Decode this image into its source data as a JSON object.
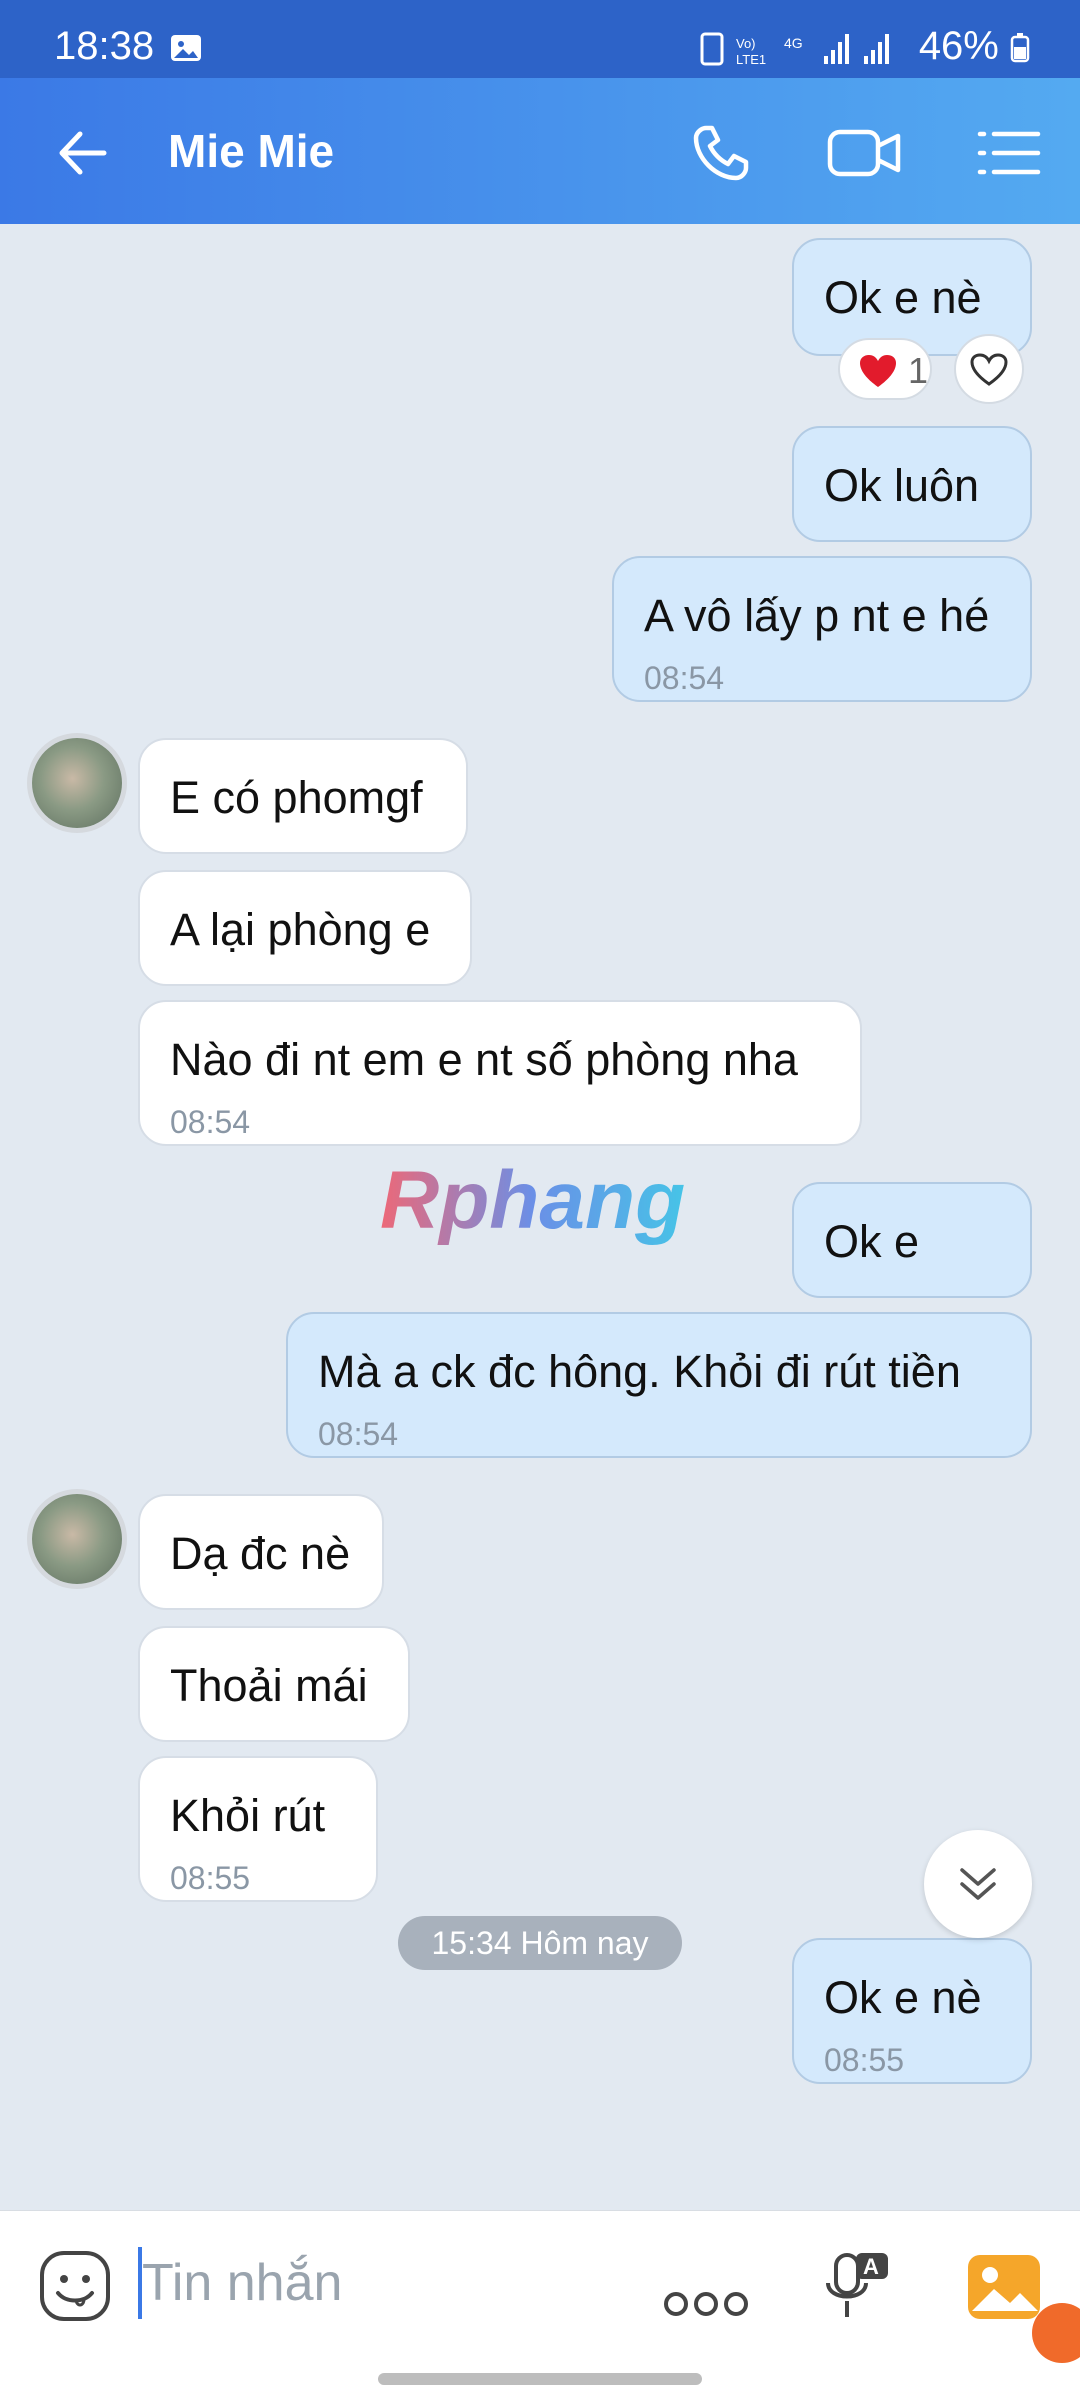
{
  "status": {
    "time": "18:38",
    "battery": "46%"
  },
  "header": {
    "title": "Mie Mie"
  },
  "messages": [
    {
      "dir": "out",
      "text": "Ok e nè",
      "time": null
    },
    {
      "dir": "out",
      "text": "Ok luôn",
      "time": null
    },
    {
      "dir": "out",
      "text": "A vô lấy p nt e hé",
      "time": "08:54"
    },
    {
      "dir": "in",
      "text": "E có phomgf",
      "time": null
    },
    {
      "dir": "in",
      "text": "A lại phòng e",
      "time": null
    },
    {
      "dir": "in",
      "text": "Nào đi nt em e nt số phòng nha",
      "time": "08:54"
    },
    {
      "dir": "out",
      "text": "Ok e",
      "time": null
    },
    {
      "dir": "out",
      "text": "Mà a ck đc hông. Khỏi đi rút tiền",
      "time": "08:54"
    },
    {
      "dir": "in",
      "text": "Dạ đc nè",
      "time": null
    },
    {
      "dir": "in",
      "text": "Thoải mái",
      "time": null
    },
    {
      "dir": "in",
      "text": "Khỏi rút",
      "time": "08:55"
    },
    {
      "dir": "out",
      "text": "Ok e nè",
      "time": "08:55"
    }
  ],
  "reaction": {
    "count": "1"
  },
  "watermark": "Rphang",
  "date_divider": "15:34 Hôm nay",
  "input": {
    "placeholder": "Tin nhắn"
  },
  "colors": {
    "header_start": "#3b79e6",
    "header_end": "#54aaf1",
    "outgoing_bubble": "#d4e9fc",
    "incoming_bubble": "#ffffff",
    "chat_background": "#e2e9f1"
  }
}
